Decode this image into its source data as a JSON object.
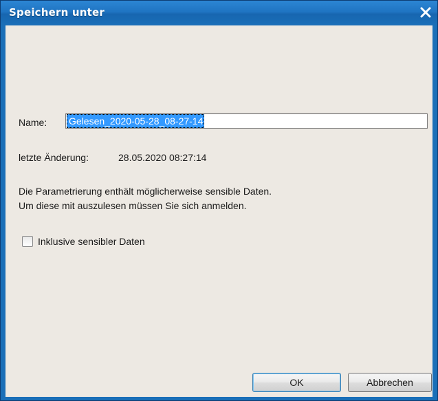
{
  "window": {
    "title": "Speichern unter"
  },
  "form": {
    "name_label": "Name:",
    "name_value": "Gelesen_2020-05-28_08-27-14",
    "last_change_label": "letzte Änderung:",
    "last_change_value": "28.05.2020 08:27:14",
    "info_line1": "Die Parametrierung enthält möglicherweise sensible Daten.",
    "info_line2": "Um diese mit auszulesen müssen Sie sich anmelden.",
    "checkbox_label": "Inklusive sensibler Daten",
    "checkbox_checked": false
  },
  "buttons": {
    "ok": "OK",
    "cancel": "Abbrechen"
  },
  "icons": {
    "close": "close-icon"
  },
  "colors": {
    "titlebar": "#1a6fb8",
    "selection": "#3399ff",
    "client_bg": "#ede9e3"
  }
}
